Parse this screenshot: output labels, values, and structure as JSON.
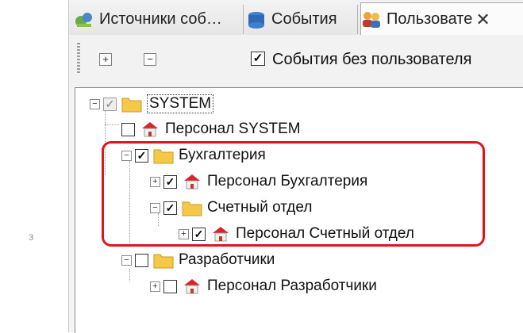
{
  "tabs": [
    {
      "label": "Источники соб…",
      "icon": "event-sources-icon"
    },
    {
      "label": "События",
      "icon": "events-icon"
    },
    {
      "label": "Пользовате",
      "icon": "users-icon",
      "close": "✕"
    }
  ],
  "toolbar": {
    "expand_symbol": "+",
    "collapse_symbol": "−",
    "checkbox_mark": "✓",
    "checkbox_label": "События без пользователя"
  },
  "tree": {
    "root": {
      "label": "SYSTEM",
      "expand": "−",
      "checked": "✓"
    },
    "system_staff": {
      "label": "Персонал SYSTEM",
      "checked": ""
    },
    "accounting": {
      "label": "Бухгалтерия",
      "expand": "−",
      "checked": "✓"
    },
    "accounting_staff": {
      "label": "Персонал Бухгалтерия",
      "expand": "+",
      "checked": "✓"
    },
    "accounts_dept": {
      "label": "Счетный отдел",
      "expand": "−",
      "checked": "✓"
    },
    "accounts_staff": {
      "label": "Персонал Счетный отдел",
      "expand": "+",
      "checked": "✓"
    },
    "developers": {
      "label": "Разработчики",
      "expand": "−",
      "checked": ""
    },
    "developers_staff": {
      "label": "Персонал Разработчики",
      "expand": "+",
      "checked": ""
    }
  },
  "side_glyph": "з",
  "colors": {
    "highlight": "#e0141e",
    "folder": "#f6c84a",
    "house_roof": "#d8252b"
  }
}
